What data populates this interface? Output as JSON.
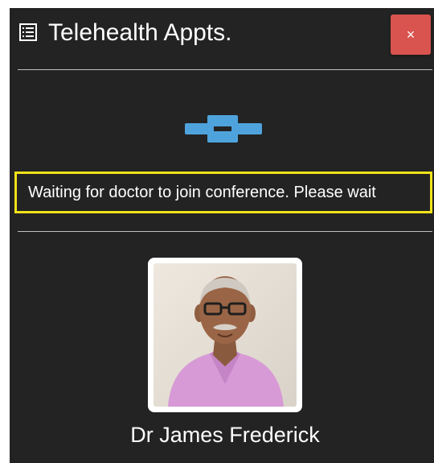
{
  "app": {
    "title": "Telehealth Appts.",
    "title_icon": "list-icon",
    "close_label": "×"
  },
  "loader": {
    "icon": "connection-loader-icon",
    "color": "#4fa3dc"
  },
  "status": {
    "message": "Waiting for doctor to join conference. Please wait",
    "highlight_color": "#f2e21a"
  },
  "doctor": {
    "name": "Dr James Frederick"
  },
  "colors": {
    "background": "#232323",
    "close_button": "#d9534f",
    "text": "#ffffff"
  }
}
